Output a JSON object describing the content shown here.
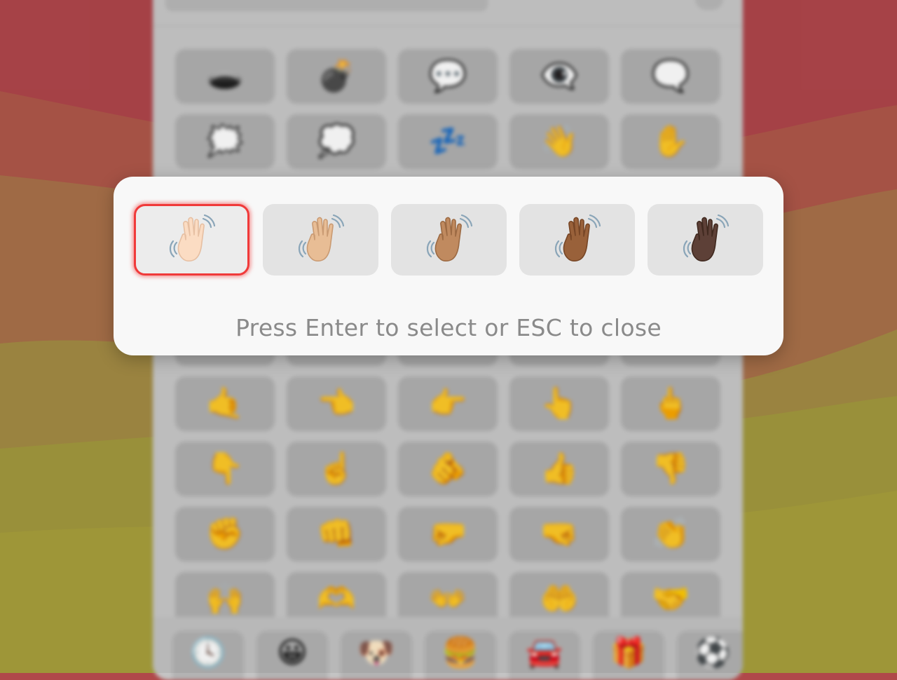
{
  "wallpaper": {
    "colors": [
      "#b0464b",
      "#b0584a",
      "#a9714a",
      "#a48c44",
      "#a39a3e",
      "#a8a03c"
    ]
  },
  "picker": {
    "background_color": "#c9c9c9",
    "visible_grid": [
      [
        "🕳️",
        "💣",
        "💬",
        "👁️‍🗨️",
        "🗨️"
      ],
      [
        "🗯️",
        "💭",
        "💤",
        "👋",
        "✋"
      ],
      [
        "🤙",
        "👈",
        "👉",
        "👆",
        "🖕"
      ],
      [
        "👇",
        "☝️",
        "🫵",
        "👍",
        "👎"
      ],
      [
        "✊",
        "👊",
        "🤛",
        "🤜",
        "👏"
      ],
      [
        "🙌",
        "🫶",
        "👐",
        "🤲",
        "🤝"
      ]
    ],
    "category_tabs": [
      {
        "icon": "clock-icon",
        "glyph": "🕓"
      },
      {
        "icon": "smiley-icon",
        "glyph": "😀"
      },
      {
        "icon": "dog-icon",
        "glyph": "🐶"
      },
      {
        "icon": "burger-icon",
        "glyph": "🍔"
      },
      {
        "icon": "car-icon",
        "glyph": "🚘"
      },
      {
        "icon": "gift-icon",
        "glyph": "🎁"
      },
      {
        "icon": "soccer-ball-icon",
        "glyph": "⚽"
      }
    ]
  },
  "skin_tone_popover": {
    "selected_index": 0,
    "accent_color": "#f03a3a",
    "options": [
      {
        "name": "waving-hand-light",
        "icon": "waving-hand-icon",
        "skin": "#fbdcc3",
        "outline": "#e6bfa2"
      },
      {
        "name": "waving-hand-medium-light",
        "icon": "waving-hand-icon",
        "skin": "#e8bd95",
        "outline": "#c99a72"
      },
      {
        "name": "waving-hand-medium",
        "icon": "waving-hand-icon",
        "skin": "#c08a5f",
        "outline": "#9c6a43"
      },
      {
        "name": "waving-hand-medium-dark",
        "icon": "waving-hand-icon",
        "skin": "#99613a",
        "outline": "#774626"
      },
      {
        "name": "waving-hand-dark",
        "icon": "waving-hand-icon",
        "skin": "#5d4037",
        "outline": "#40291f"
      }
    ],
    "hint": "Press Enter to select or ESC to close"
  }
}
